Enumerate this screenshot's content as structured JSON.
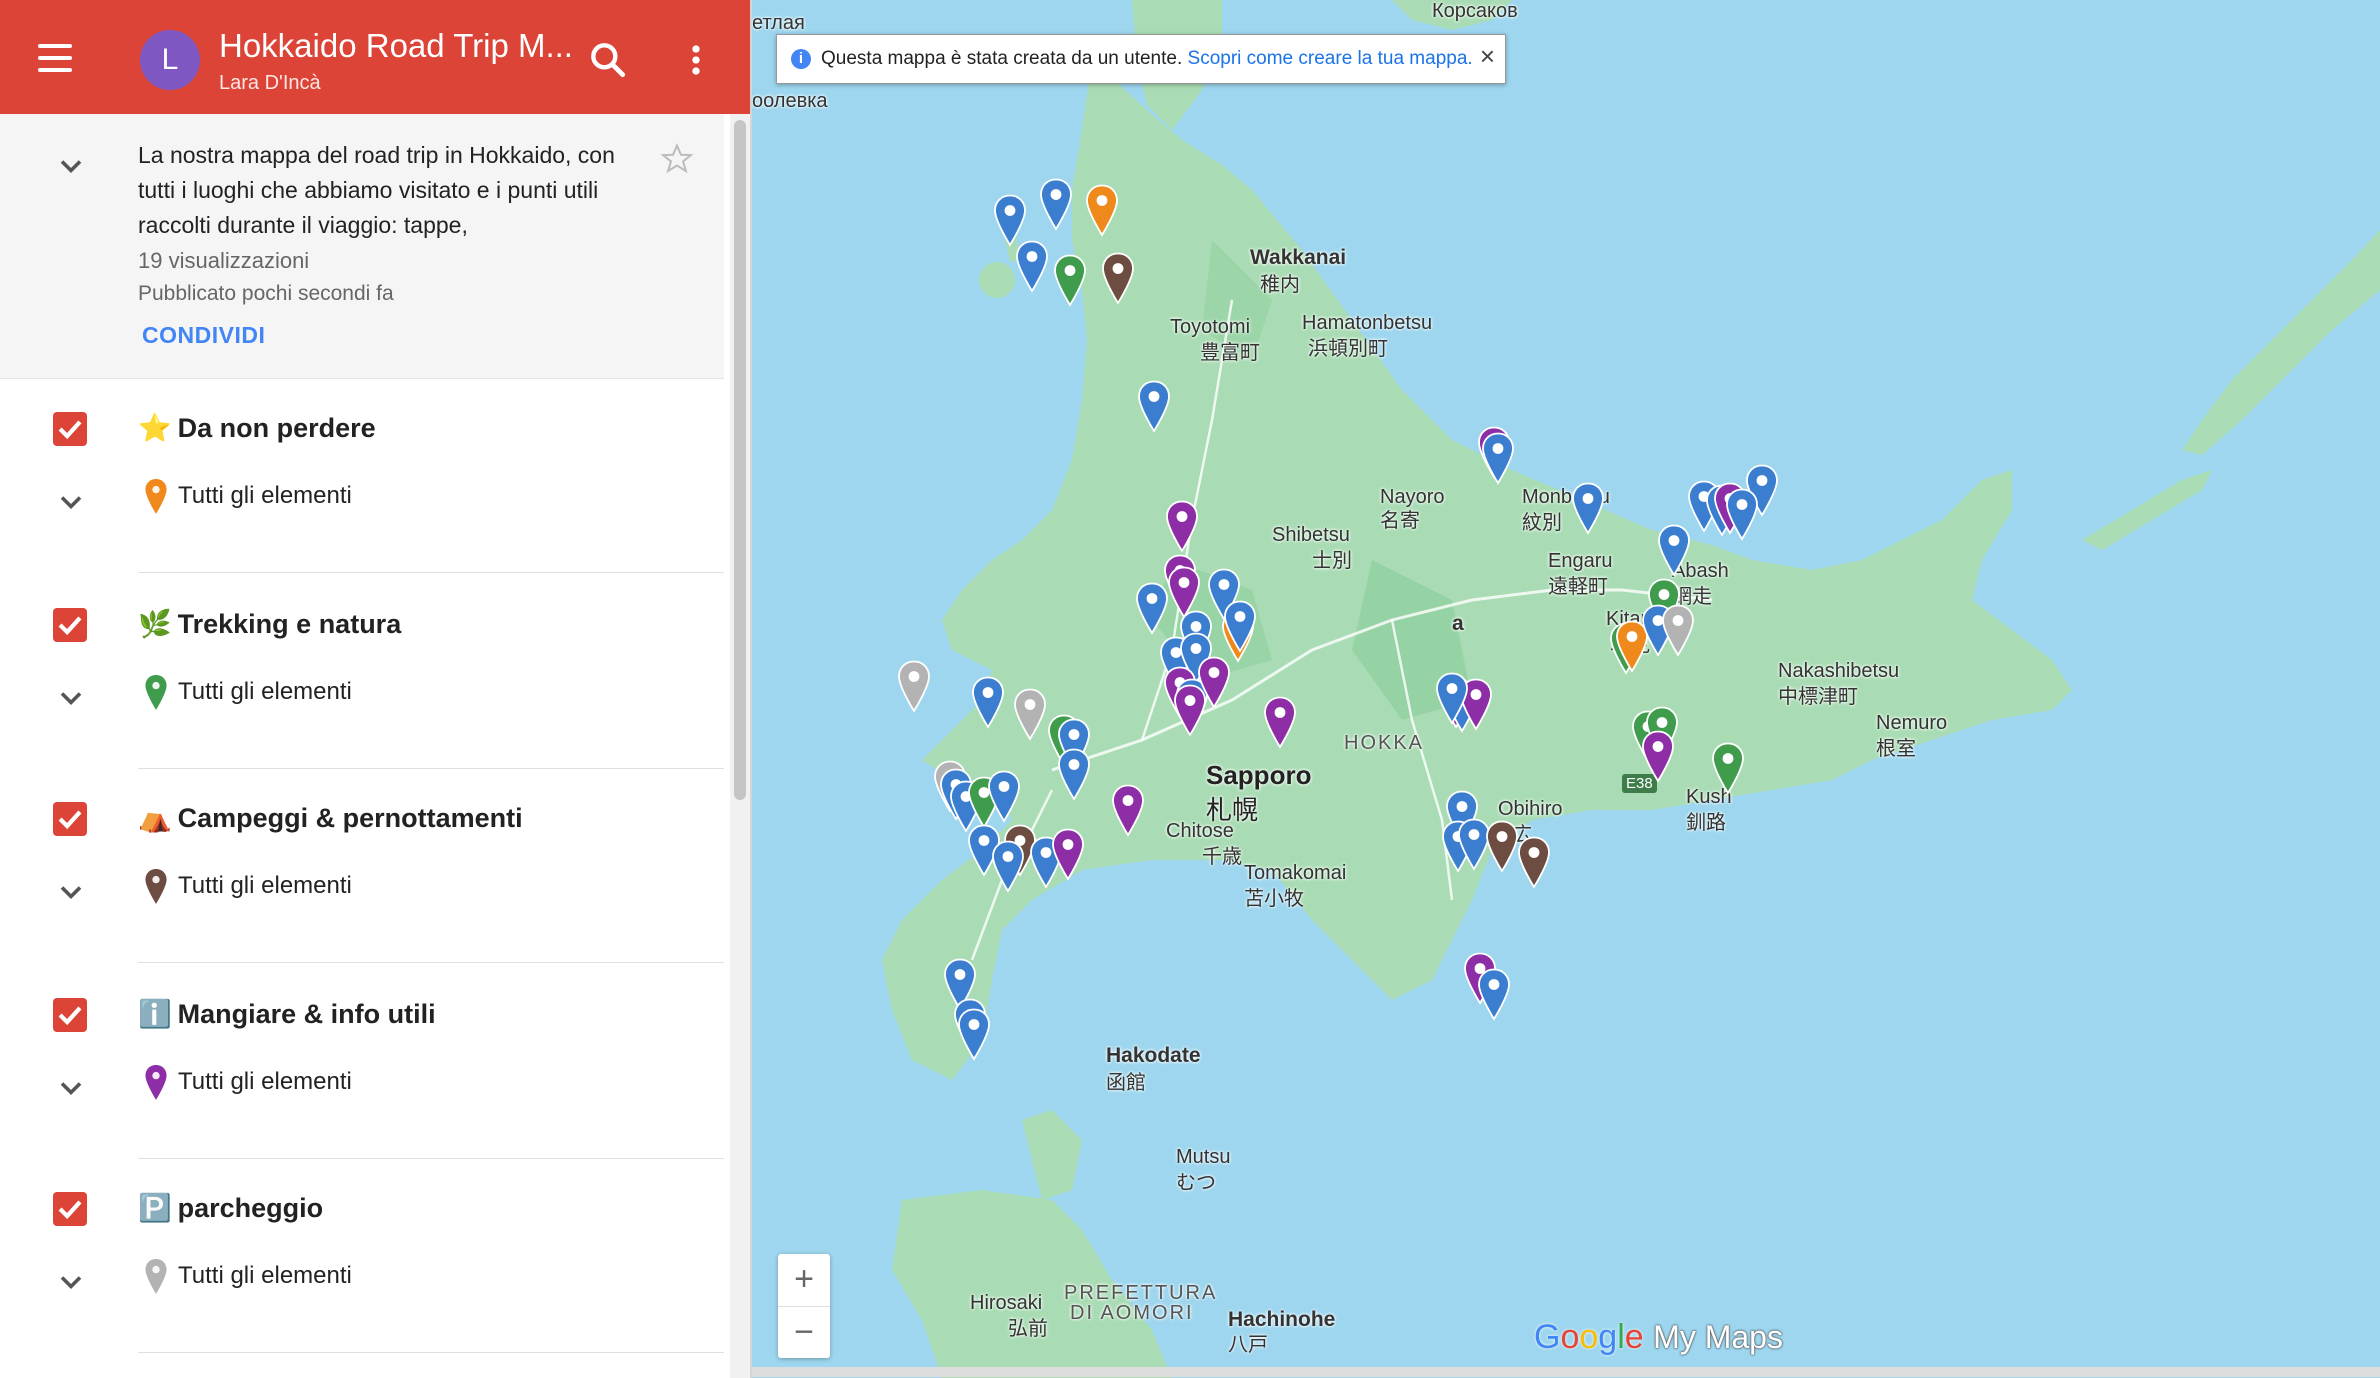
{
  "header": {
    "title": "Hokkaido Road Trip M...",
    "author": "Lara D'Incà",
    "avatar_letter": "L",
    "bg_color": "#db4437"
  },
  "description": {
    "text": "La nostra mappa del road trip in Hokkaido, con tutti i luoghi che abbiamo visitato e i punti utili raccolti durante il viaggio: tappe,",
    "views": "19 visualizzazioni",
    "published": "Pubblicato pochi secondi fa",
    "share_label": "CONDIVIDI"
  },
  "layers": [
    {
      "emoji": "⭐",
      "name": "Da non perdere",
      "items_label": "Tutti gli elementi",
      "pin_color": "#f0891c"
    },
    {
      "emoji": "🌿",
      "name": "Trekking e natura",
      "items_label": "Tutti gli elementi",
      "pin_color": "#3f9c4c"
    },
    {
      "emoji": "⛺",
      "name": "Campeggi & pernottamenti",
      "items_label": "Tutti gli elementi",
      "pin_color": "#6d4c41"
    },
    {
      "emoji": "ℹ️",
      "name": "Mangiare & info utili",
      "items_label": "Tutti gli elementi",
      "pin_color": "#8e2ea7"
    },
    {
      "emoji": "🅿️",
      "name": "parcheggio",
      "items_label": "Tutti gli elementi",
      "pin_color": "#b3b3b3"
    }
  ],
  "banner": {
    "message": "Questa mappa è stata creata da un utente.",
    "link": "Scopri come creare la tua mappa.",
    "close": "×"
  },
  "zoom": {
    "plus": "+",
    "minus": "−"
  },
  "logo": {
    "g1": "G",
    "g2": "o",
    "g3": "o",
    "g4": "g",
    "g5": "l",
    "g6": "e",
    "suffix": "My Maps"
  },
  "places": {
    "wakkanai": "Wakkanai",
    "wakkanai_jp": "稚内",
    "toyotomi": "Toyotomi",
    "toyotomi_jp": "豊富町",
    "hamatonbetsu": "Hamatonbetsu",
    "hamatonbetsu_jp": "浜頓別町",
    "nayoro": "Nayoro",
    "nayoro_jp": "名寄",
    "shibetsu": "Shibetsu",
    "shibetsu_jp": "士別",
    "monbetsu": "Monbetsu",
    "monbetsu_jp": "紋別",
    "engaru": "Engaru",
    "engaru_jp": "遠軽町",
    "abashiri": "Abash",
    "abashiri_jp": "網走",
    "kitami": "Kitami",
    "kitami_jp": "北見",
    "nakashibetsu": "Nakashibetsu",
    "nakashibetsu_jp": "中標津町",
    "nemuro": "Nemuro",
    "nemuro_jp": "根室",
    "sapporo": "Sapporo",
    "sapporo_jp": "札幌",
    "chitose": "Chitose",
    "chitose_jp": "千歳",
    "tomakomai": "Tomakomai",
    "tomakomai_jp": "苫小牧",
    "obihiro": "Obihiro",
    "obihiro_jp": "帯広",
    "kushiro": "Kush",
    "kushiro_jp": "釧路",
    "hakodate": "Hakodate",
    "hakodate_jp": "函館",
    "mutsu": "Mutsu",
    "mutsu_jp": "むつ",
    "hirosaki": "Hirosaki",
    "hirosaki_jp": "弘前",
    "aomori": "PREFETTURA",
    "aomori2": "DI AOMORI",
    "hachinohe": "Hachinohe",
    "hachinohe_jp": "八戸",
    "hokkaido": "HOKKA",
    "asahikawa": "a",
    "top_left1": "етлая",
    "top_left2": "оолевка",
    "top_right": "Корсаков",
    "route": "E38"
  }
}
